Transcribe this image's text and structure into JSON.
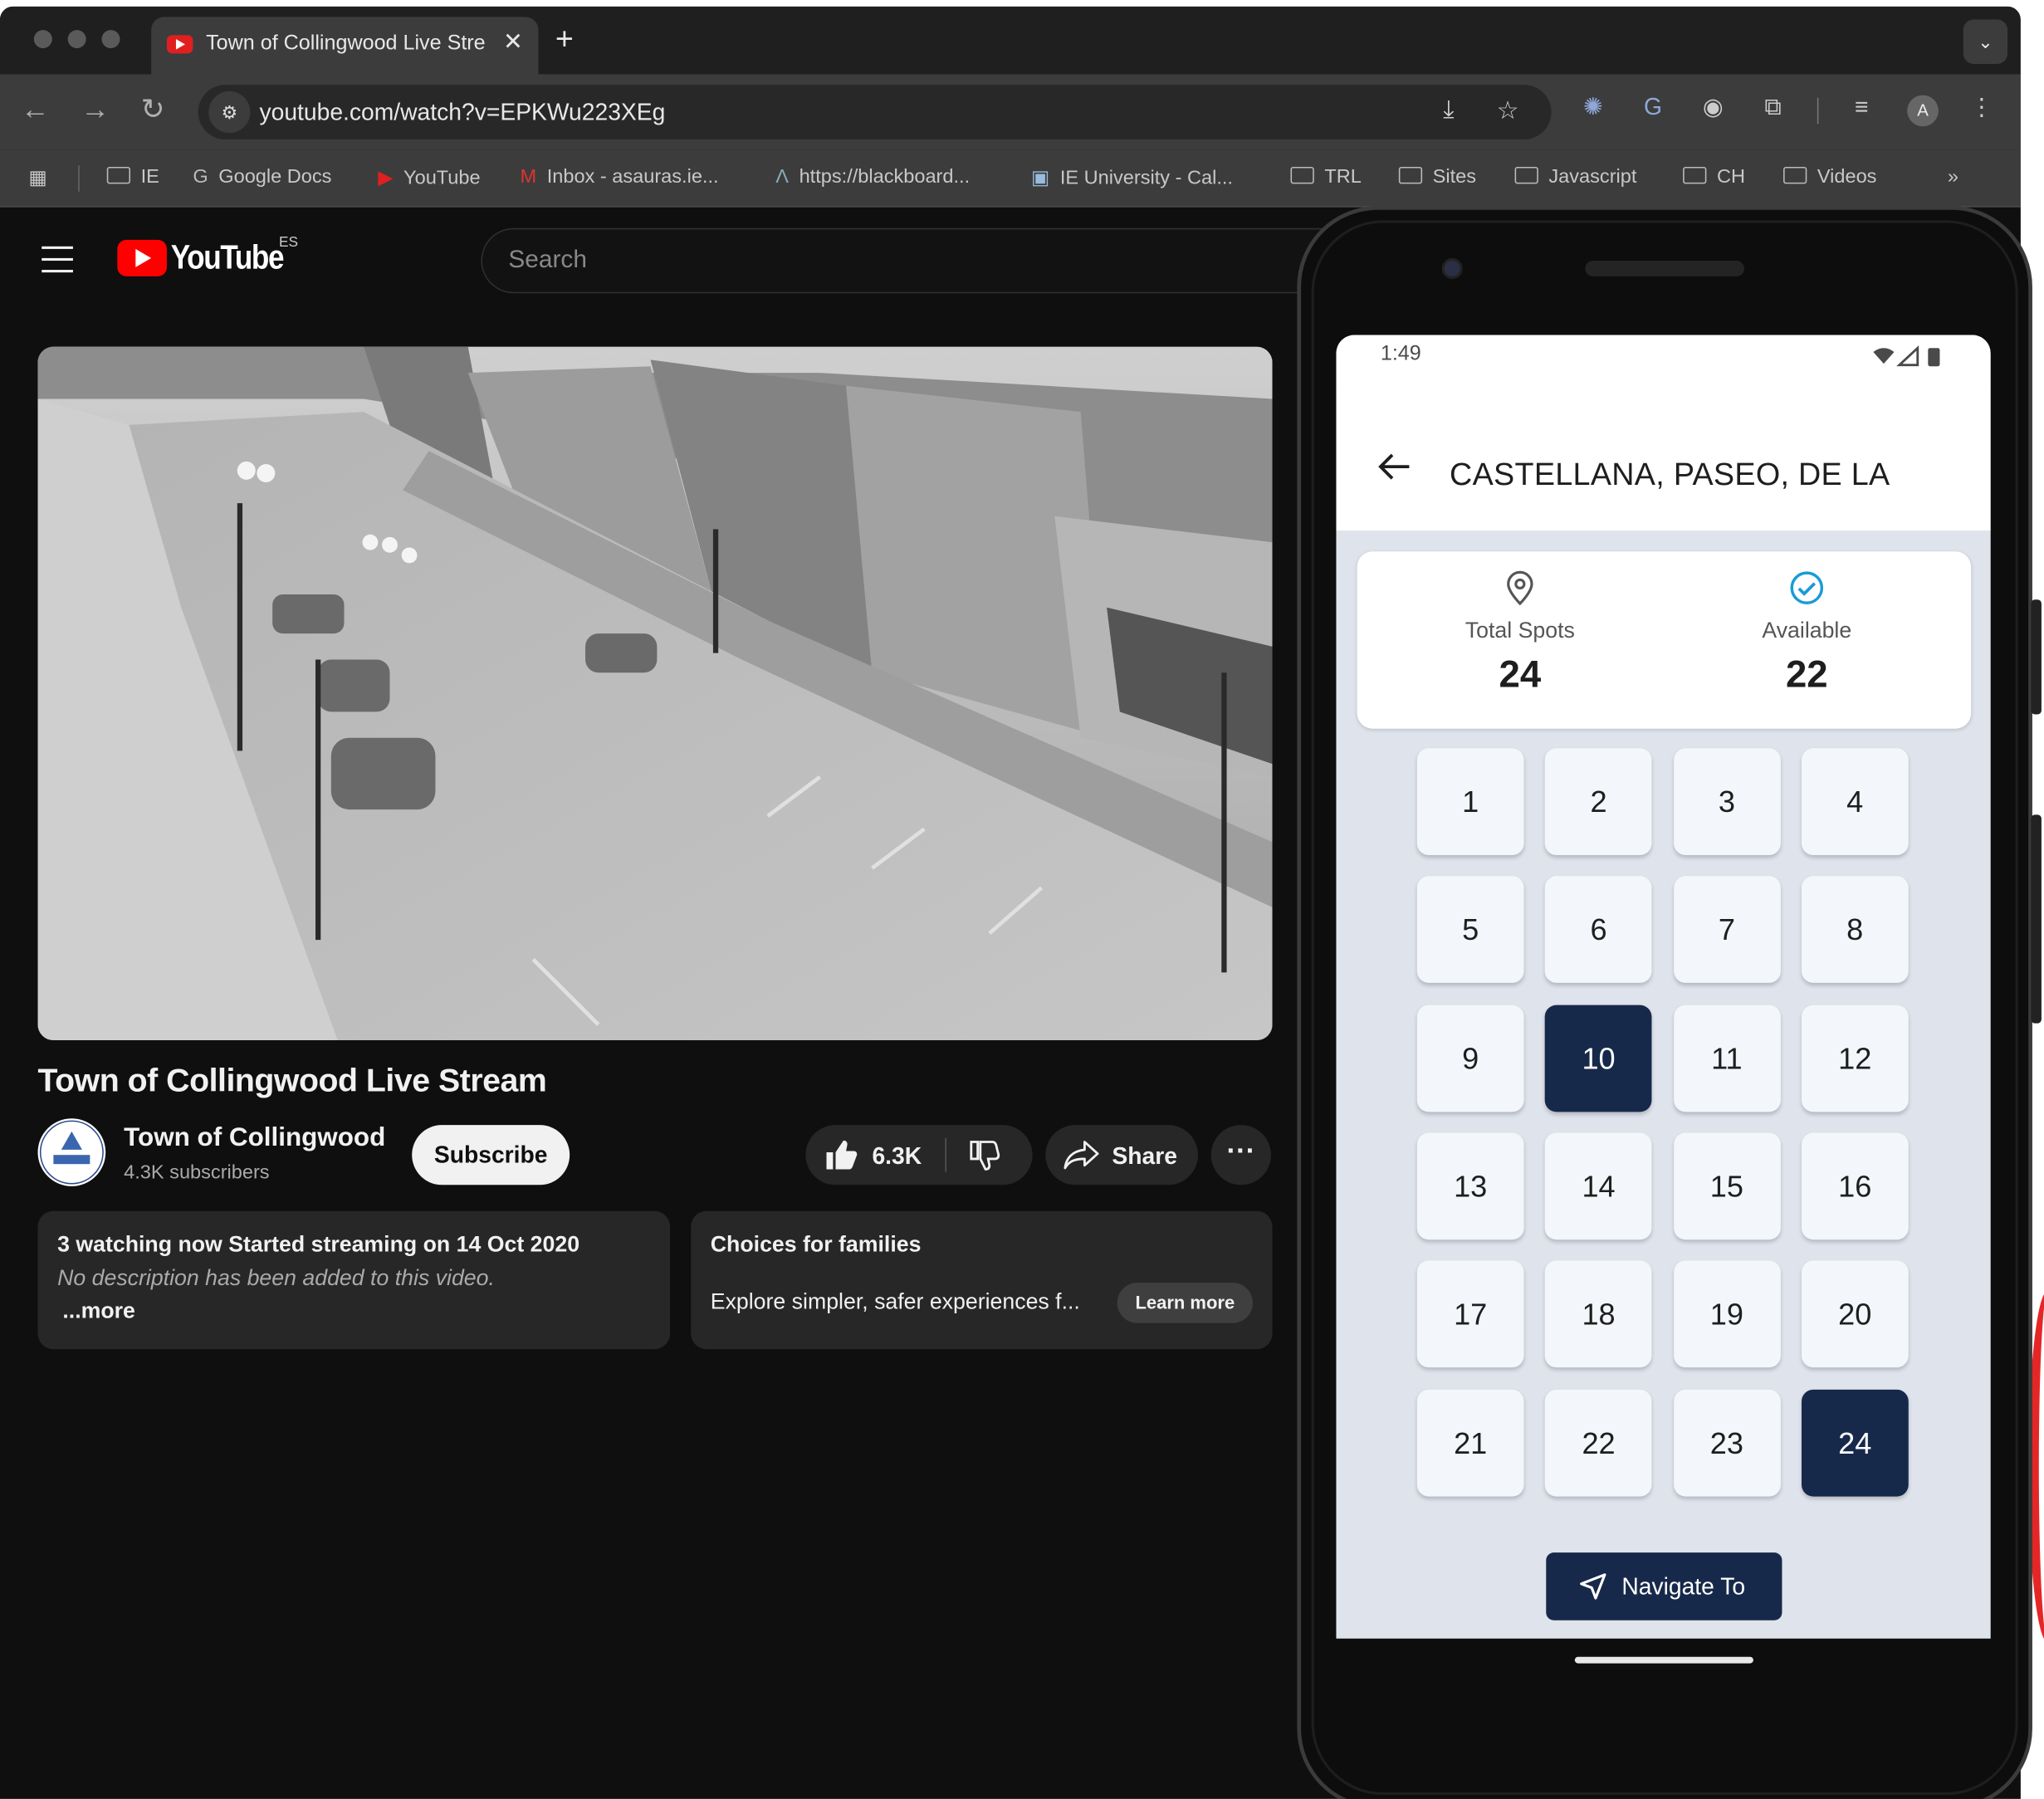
{
  "browser": {
    "tab_title": "Town of Collingwood Live Stream",
    "url": "youtube.com/watch?v=EPKWu223XEg",
    "bookmarks": [
      {
        "label": "IE",
        "icon": "folder-icon"
      },
      {
        "label": "Google Docs",
        "icon": "google-icon"
      },
      {
        "label": "YouTube",
        "icon": "youtube-icon"
      },
      {
        "label": "Inbox - asauras.ie...",
        "icon": "gmail-icon"
      },
      {
        "label": "https://blackboard...",
        "icon": "blackboard-icon"
      },
      {
        "label": "IE University - Cal...",
        "icon": "calendar-icon"
      },
      {
        "label": "TRL",
        "icon": "folder-icon"
      },
      {
        "label": "Sites",
        "icon": "folder-icon"
      },
      {
        "label": "Javascript",
        "icon": "folder-icon"
      },
      {
        "label": "CH",
        "icon": "folder-icon"
      },
      {
        "label": "Videos",
        "icon": "folder-icon"
      }
    ],
    "profile_initial": "A"
  },
  "youtube": {
    "logo_text": "YouTube",
    "region": "ES",
    "search_placeholder": "Search",
    "video_title": "Town of Collingwood Live Stream",
    "channel_name": "Town of Collingwood",
    "subscribers": "4.3K subscribers",
    "subscribe_label": "Subscribe",
    "likes": "6.3K",
    "share_label": "Share",
    "description": {
      "stats": "3 watching now  Started streaming on 14 Oct 2020",
      "text": "No description has been added to this video.",
      "more": "...more"
    },
    "promo": {
      "title": "Choices for families",
      "subtitle": "Explore simpler, safer experiences f...",
      "button": "Learn more"
    }
  },
  "phone_app": {
    "time": "1:49",
    "street": "CASTELLANA, PASEO, DE LA",
    "total_label": "Total Spots",
    "total_value": "24",
    "available_label": "Available",
    "available_value": "22",
    "spots": [
      "1",
      "2",
      "3",
      "4",
      "5",
      "6",
      "7",
      "8",
      "9",
      "10",
      "11",
      "12",
      "13",
      "14",
      "15",
      "16",
      "17",
      "18",
      "19",
      "20",
      "21",
      "22",
      "23",
      "24"
    ],
    "selected_spots": [
      "10",
      "24"
    ],
    "navigate_label": "Navigate To",
    "colors": {
      "selected": "#17294a",
      "accent": "#1a9bd7"
    }
  }
}
